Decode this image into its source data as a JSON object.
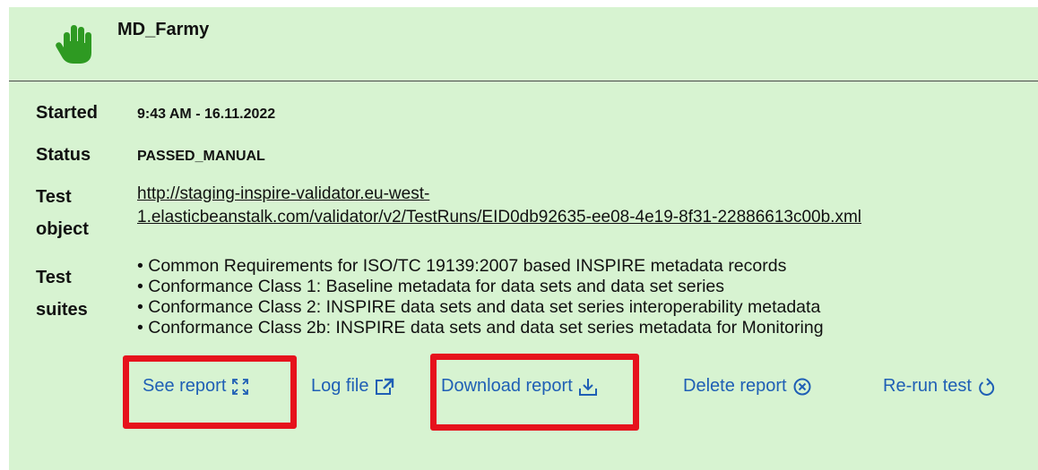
{
  "header": {
    "title": "MD_Farmy",
    "icon": "hand-icon"
  },
  "fields": {
    "started_label": "Started",
    "started_value": "9:43 AM - 16.11.2022",
    "status_label": "Status",
    "status_value": "PASSED_MANUAL",
    "test_object_label_1": "Test",
    "test_object_label_2": "object",
    "test_object_link_1": "http://staging-inspire-validator.eu-west-",
    "test_object_link_2": "1.elasticbeanstalk.com/validator/v2/TestRuns/EID0db92635-ee08-4e19-8f31-22886613c00b.xml",
    "test_suites_label_1": "Test",
    "test_suites_label_2": "suites"
  },
  "suites": [
    "• Common Requirements for ISO/TC 19139:2007 based INSPIRE metadata records",
    "• Conformance Class 1: Baseline metadata for data sets and data set series",
    "• Conformance Class 2: INSPIRE data sets and data set series interoperability metadata",
    "• Conformance Class 2b: INSPIRE data sets and data set series metadata for Monitoring"
  ],
  "actions": {
    "see_report": "See report",
    "log_file": "Log file",
    "download_report": "Download report",
    "delete_report": "Delete report",
    "rerun_test": "Re-run test"
  },
  "colors": {
    "panel_bg": "#d7f3d1",
    "link_blue": "#1f5fb5",
    "highlight_red": "#e6121c",
    "hand_green": "#2e9a22"
  }
}
